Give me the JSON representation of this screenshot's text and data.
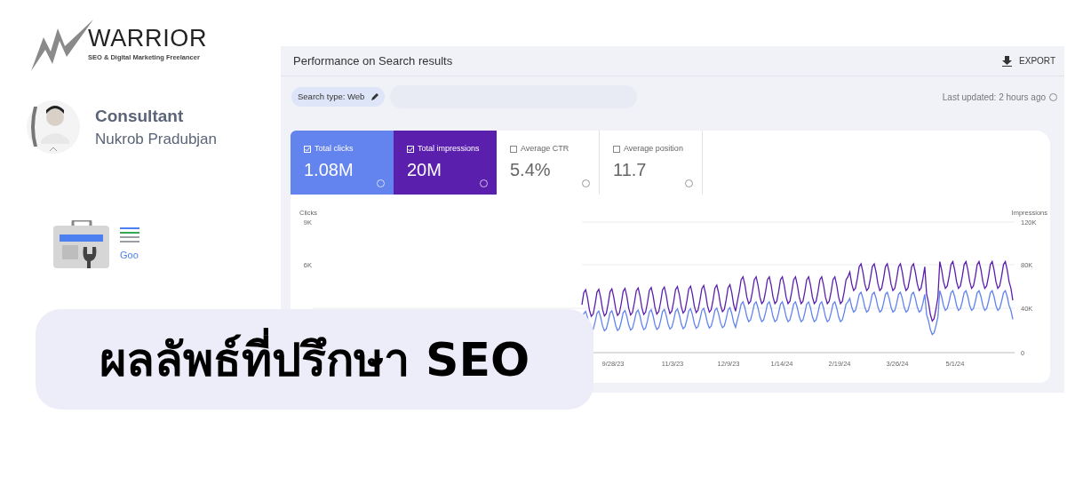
{
  "logo": {
    "name": "WARRIOR",
    "tagline": "SEO & Digital Marketing Freelancer"
  },
  "profile": {
    "role": "Consultant",
    "name": "Nukrob Pradubjan"
  },
  "app_icon": {
    "caption": "Goo"
  },
  "report": {
    "title": "Performance on Search results",
    "export": "EXPORT",
    "chip": "Search type: Web",
    "last_updated": "Last updated: 2 hours ago",
    "metrics": [
      {
        "label": "Total clicks",
        "value": "1.08M",
        "checked": true,
        "color": "#6383ee"
      },
      {
        "label": "Total impressions",
        "value": "20M",
        "checked": true,
        "color": "#5b1fae"
      },
      {
        "label": "Average CTR",
        "value": "5.4%",
        "checked": false
      },
      {
        "label": "Average position",
        "value": "11.7",
        "checked": false
      }
    ],
    "chart": {
      "left_title": "Clicks",
      "left_ticks": [
        "9K",
        "6K"
      ],
      "right_title": "Impressions",
      "right_ticks": [
        "120K",
        "80K",
        "40K",
        "0"
      ],
      "x_labels": [
        "9/28/23",
        "11/3/23",
        "12/9/23",
        "1/14/24",
        "2/19/24",
        "3/26/24",
        "5/1/24"
      ]
    }
  },
  "banner": {
    "text": "ผลลัพธ์ที่ปรึกษา SEO"
  }
}
